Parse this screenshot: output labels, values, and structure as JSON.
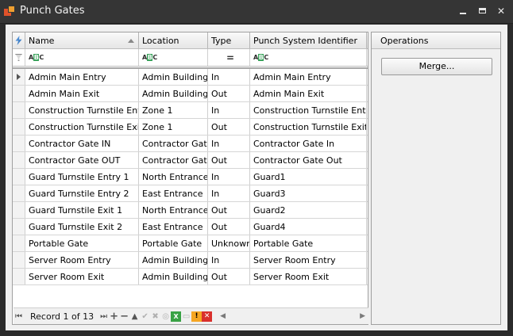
{
  "window": {
    "title": "Punch Gates"
  },
  "grid": {
    "columns": [
      "Name",
      "Location",
      "Type",
      "Punch System Identifier"
    ],
    "rows": [
      [
        "Admin Main Entry",
        "Admin Building",
        "In",
        "Admin Main Entry"
      ],
      [
        "Admin Main Exit",
        "Admin Building",
        "Out",
        "Admin Main Exit"
      ],
      [
        "Construction Turnstile Entry",
        "Zone 1",
        "In",
        "Construction Turnstile Entry"
      ],
      [
        "Construction Turnstile Exit",
        "Zone 1",
        "Out",
        "Construction Turnstile Exit"
      ],
      [
        "Contractor Gate IN",
        "Contractor Gate",
        "In",
        "Contractor Gate In"
      ],
      [
        "Contractor Gate OUT",
        "Contractor Gate",
        "Out",
        "Contractor Gate Out"
      ],
      [
        "Guard Turnstile Entry 1",
        "North Entrance",
        "In",
        "Guard1"
      ],
      [
        "Guard Turnstile Entry 2",
        "East Entrance",
        "In",
        "Guard3"
      ],
      [
        "Guard Turnstile Exit 1",
        "North Entrance",
        "Out",
        "Guard2"
      ],
      [
        "Guard Turnstile Exit 2",
        "East Entrance",
        "Out",
        "Guard4"
      ],
      [
        "Portable Gate",
        "Portable Gate",
        "Unknown",
        "Portable Gate"
      ],
      [
        "Server Room Entry",
        "Admin Building",
        "In",
        "Server Room Entry"
      ],
      [
        "Server Room Exit",
        "Admin Building",
        "Out",
        "Server Room Exit"
      ]
    ]
  },
  "navigator": {
    "record_text": "Record 1 of 13"
  },
  "operations": {
    "title": "Operations",
    "merge_label": "Merge..."
  }
}
